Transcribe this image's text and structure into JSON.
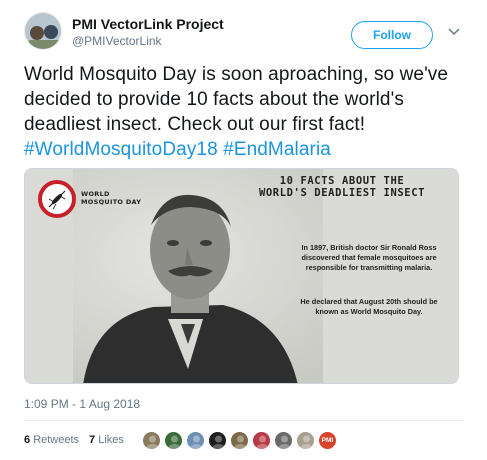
{
  "tweet": {
    "author_name": "PMI VectorLink Project",
    "author_handle": "@PMIVectorLink",
    "follow_label": "Follow",
    "text_plain": "World Mosquito Day is soon aproaching, so we've decided to provide 10 facts about the world's deadliest insect. Check out our first fact! ",
    "hashtags": [
      "#WorldMosquitoDay18",
      "#EndMalaria"
    ],
    "timestamp": "1:09 PM - 1 Aug 2018",
    "retweets_count": "6",
    "retweets_label": "Retweets",
    "likes_count": "7",
    "likes_label": "Likes"
  },
  "media": {
    "logo_line1": "WORLD",
    "logo_line2": "MOSQUITO DAY",
    "title_line1": "10 FACTS ABOUT THE",
    "title_line2": "WORLD'S DEADLIEST INSECT",
    "paragraph1": "In 1897, British doctor Sir Ronald Ross discovered that female mosquitoes are responsible for transmitting malaria.",
    "paragraph2": "He declared that August 20th should be known as World Mosquito Day."
  },
  "likers": [
    {
      "icon": "avatar-1",
      "color": "#8a7a5c"
    },
    {
      "icon": "avatar-2",
      "color": "#3b6b3a"
    },
    {
      "icon": "avatar-3",
      "color": "#6e8fb3"
    },
    {
      "icon": "avatar-4",
      "color": "#1e1e1e"
    },
    {
      "icon": "avatar-5",
      "color": "#7b6b4b"
    },
    {
      "icon": "avatar-6",
      "color": "#b73a48"
    },
    {
      "icon": "avatar-7",
      "color": "#6a6a6a"
    },
    {
      "icon": "avatar-8",
      "color": "#a89f90"
    }
  ],
  "liker_pmi_label": "PMI",
  "colors": {
    "accent": "#1da1f2",
    "hashtag": "#1b95e0",
    "muted": "#657786"
  }
}
